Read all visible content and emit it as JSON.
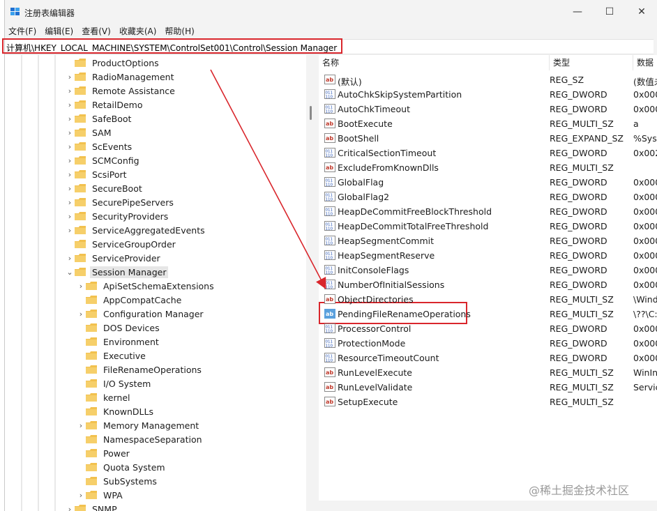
{
  "window": {
    "title": "注册表编辑器",
    "controls": {
      "minimize": "—",
      "maximize": "☐",
      "close": "✕"
    }
  },
  "menu": [
    "文件(F)",
    "编辑(E)",
    "查看(V)",
    "收藏夹(A)",
    "帮助(H)"
  ],
  "address": "计算机\\HKEY_LOCAL_MACHINE\\SYSTEM\\ControlSet001\\Control\\Session Manager",
  "tree": {
    "items": [
      {
        "label": "ProductOptions",
        "level": 1,
        "expander": "none"
      },
      {
        "label": "RadioManagement",
        "level": 1,
        "expander": "collapsed"
      },
      {
        "label": "Remote Assistance",
        "level": 1,
        "expander": "collapsed"
      },
      {
        "label": "RetailDemo",
        "level": 1,
        "expander": "collapsed"
      },
      {
        "label": "SafeBoot",
        "level": 1,
        "expander": "collapsed"
      },
      {
        "label": "SAM",
        "level": 1,
        "expander": "collapsed"
      },
      {
        "label": "ScEvents",
        "level": 1,
        "expander": "collapsed"
      },
      {
        "label": "SCMConfig",
        "level": 1,
        "expander": "collapsed"
      },
      {
        "label": "ScsiPort",
        "level": 1,
        "expander": "collapsed"
      },
      {
        "label": "SecureBoot",
        "level": 1,
        "expander": "collapsed"
      },
      {
        "label": "SecurePipeServers",
        "level": 1,
        "expander": "collapsed"
      },
      {
        "label": "SecurityProviders",
        "level": 1,
        "expander": "collapsed"
      },
      {
        "label": "ServiceAggregatedEvents",
        "level": 1,
        "expander": "collapsed"
      },
      {
        "label": "ServiceGroupOrder",
        "level": 1,
        "expander": "none"
      },
      {
        "label": "ServiceProvider",
        "level": 1,
        "expander": "collapsed"
      },
      {
        "label": "Session Manager",
        "level": 1,
        "expander": "expanded",
        "selected": true
      },
      {
        "label": "ApiSetSchemaExtensions",
        "level": 2,
        "expander": "collapsed"
      },
      {
        "label": "AppCompatCache",
        "level": 2,
        "expander": "none"
      },
      {
        "label": "Configuration Manager",
        "level": 2,
        "expander": "collapsed"
      },
      {
        "label": "DOS Devices",
        "level": 2,
        "expander": "none"
      },
      {
        "label": "Environment",
        "level": 2,
        "expander": "none"
      },
      {
        "label": "Executive",
        "level": 2,
        "expander": "none"
      },
      {
        "label": "FileRenameOperations",
        "level": 2,
        "expander": "none"
      },
      {
        "label": "I/O System",
        "level": 2,
        "expander": "none"
      },
      {
        "label": "kernel",
        "level": 2,
        "expander": "none"
      },
      {
        "label": "KnownDLLs",
        "level": 2,
        "expander": "none"
      },
      {
        "label": "Memory Management",
        "level": 2,
        "expander": "collapsed"
      },
      {
        "label": "NamespaceSeparation",
        "level": 2,
        "expander": "none"
      },
      {
        "label": "Power",
        "level": 2,
        "expander": "none"
      },
      {
        "label": "Quota System",
        "level": 2,
        "expander": "none"
      },
      {
        "label": "SubSystems",
        "level": 2,
        "expander": "none"
      },
      {
        "label": "WPA",
        "level": 2,
        "expander": "collapsed"
      },
      {
        "label": "SNMP",
        "level": 1,
        "expander": "collapsed"
      }
    ]
  },
  "values": {
    "columns": {
      "name": "名称",
      "type": "类型",
      "data": "数据"
    },
    "rows": [
      {
        "name": "(默认)",
        "type": "REG_SZ",
        "data": "(数值未",
        "icon": "string"
      },
      {
        "name": "AutoChkSkipSystemPartition",
        "type": "REG_DWORD",
        "data": "0x000",
        "icon": "binary"
      },
      {
        "name": "AutoChkTimeout",
        "type": "REG_DWORD",
        "data": "0x000",
        "icon": "binary"
      },
      {
        "name": "BootExecute",
        "type": "REG_MULTI_SZ",
        "data": "a",
        "icon": "string"
      },
      {
        "name": "BootShell",
        "type": "REG_EXPAND_SZ",
        "data": "%Syst",
        "icon": "string"
      },
      {
        "name": "CriticalSectionTimeout",
        "type": "REG_DWORD",
        "data": "0x002",
        "icon": "binary"
      },
      {
        "name": "ExcludeFromKnownDlls",
        "type": "REG_MULTI_SZ",
        "data": "",
        "icon": "string"
      },
      {
        "name": "GlobalFlag",
        "type": "REG_DWORD",
        "data": "0x000",
        "icon": "binary"
      },
      {
        "name": "GlobalFlag2",
        "type": "REG_DWORD",
        "data": "0x000",
        "icon": "binary"
      },
      {
        "name": "HeapDeCommitFreeBlockThreshold",
        "type": "REG_DWORD",
        "data": "0x000",
        "icon": "binary"
      },
      {
        "name": "HeapDeCommitTotalFreeThreshold",
        "type": "REG_DWORD",
        "data": "0x000",
        "icon": "binary"
      },
      {
        "name": "HeapSegmentCommit",
        "type": "REG_DWORD",
        "data": "0x000",
        "icon": "binary"
      },
      {
        "name": "HeapSegmentReserve",
        "type": "REG_DWORD",
        "data": "0x000",
        "icon": "binary"
      },
      {
        "name": "InitConsoleFlags",
        "type": "REG_DWORD",
        "data": "0x000",
        "icon": "binary"
      },
      {
        "name": "NumberOfInitialSessions",
        "type": "REG_DWORD",
        "data": "0x000",
        "icon": "binary"
      },
      {
        "name": "ObjectDirectories",
        "type": "REG_MULTI_SZ",
        "data": "\\Wind",
        "icon": "string"
      },
      {
        "name": "PendingFileRenameOperations",
        "type": "REG_MULTI_SZ",
        "data": "\\??\\C:",
        "icon": "string",
        "selected": true
      },
      {
        "name": "ProcessorControl",
        "type": "REG_DWORD",
        "data": "0x000",
        "icon": "binary"
      },
      {
        "name": "ProtectionMode",
        "type": "REG_DWORD",
        "data": "0x000",
        "icon": "binary"
      },
      {
        "name": "ResourceTimeoutCount",
        "type": "REG_DWORD",
        "data": "0x000",
        "icon": "binary"
      },
      {
        "name": "RunLevelExecute",
        "type": "REG_MULTI_SZ",
        "data": "WinIn",
        "icon": "string"
      },
      {
        "name": "RunLevelValidate",
        "type": "REG_MULTI_SZ",
        "data": "Servic",
        "icon": "string"
      },
      {
        "name": "SetupExecute",
        "type": "REG_MULTI_SZ",
        "data": "",
        "icon": "string"
      }
    ]
  },
  "watermark": "@稀土掘金技术社区",
  "colors": {
    "annotation_red": "#d9262c",
    "folder_yellow": "#f2c14e",
    "selection_gray": "#e6e6e6"
  }
}
